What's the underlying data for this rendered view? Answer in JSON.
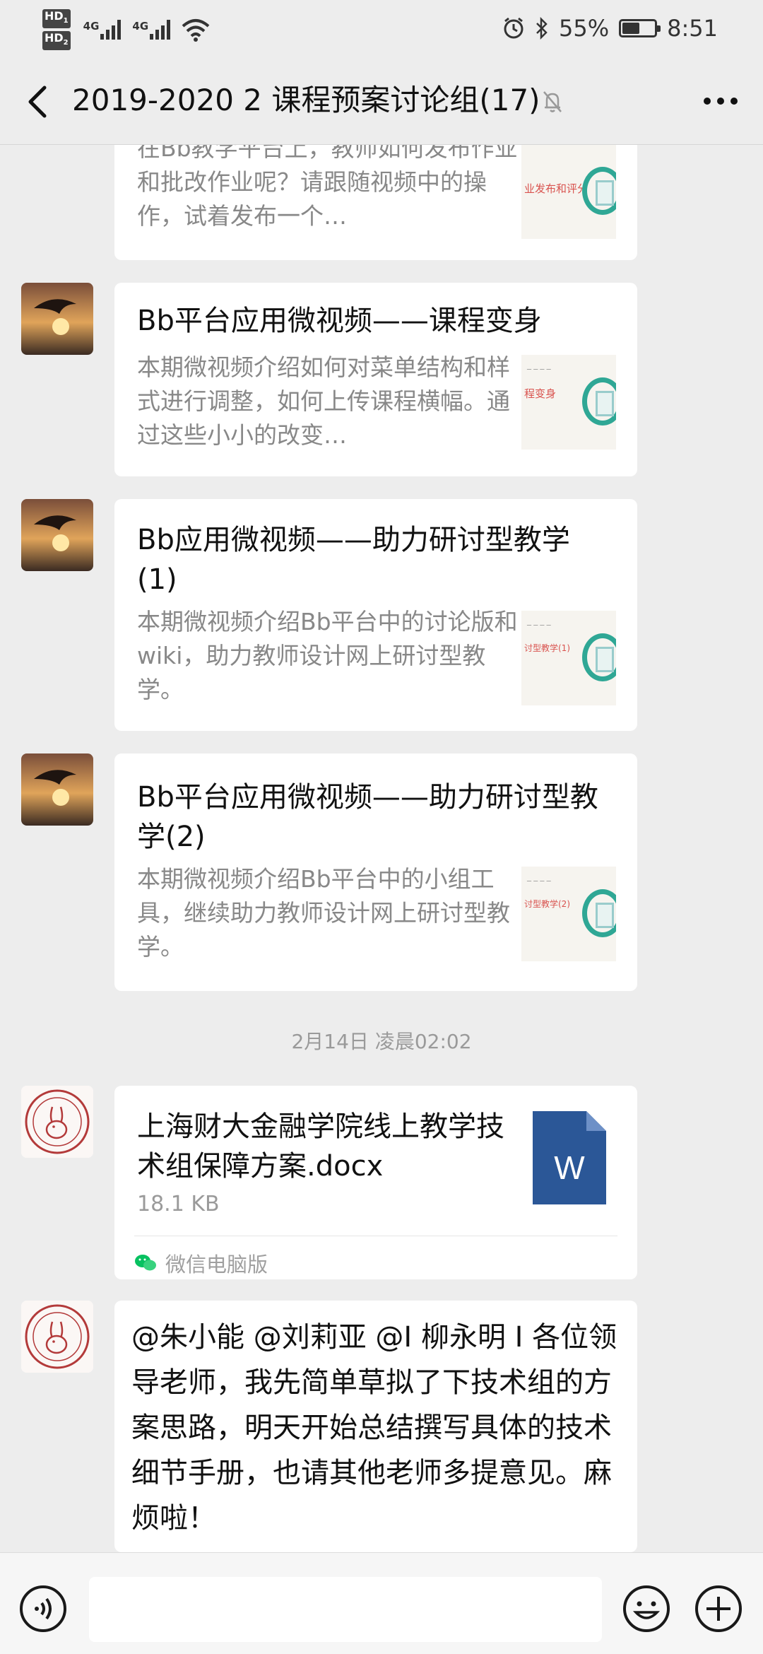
{
  "status_bar": {
    "hd_labels": [
      "HD",
      "HD"
    ],
    "hd_sub": [
      "1",
      "2"
    ],
    "signal_labels": [
      "4G",
      "4G"
    ],
    "battery_percent": "55%",
    "battery_level": 0.55,
    "time": "8:51"
  },
  "header": {
    "title": "2019-2020 2 课程预案讨论组(17)",
    "back_icon": "chevron-left-icon",
    "mute_icon": "bell-off-icon",
    "more_icon": "more-dots-icon"
  },
  "messages": [
    {
      "type": "link_card",
      "title": "",
      "description": "在Bb教学平台上，教师如何发布作业和批改作业呢？请跟随视频中的操作，试着发布一个…",
      "thumbnail_text": "业发布和评分"
    },
    {
      "type": "link_card",
      "title": "Bb平台应用微视频——课程变身",
      "description": "本期微视频介绍如何对菜单结构和样式进行调整，如何上传课程横幅。通过这些小小的改变…",
      "thumbnail_text": "程变身"
    },
    {
      "type": "link_card",
      "title": "Bb应用微视频——助力研讨型教学(1)",
      "description": "本期微视频介绍Bb平台中的讨论版和wiki，助力教师设计网上研讨型教学。",
      "thumbnail_text": "讨型教学(1)"
    },
    {
      "type": "link_card",
      "title": "Bb平台应用微视频——助力研讨型教学(2)",
      "description": "本期微视频介绍Bb平台中的小组工具，继续助力教师设计网上研讨型教学。",
      "thumbnail_text": "讨型教学(2)"
    }
  ],
  "timestamp": "2月14日 凌晨02:02",
  "file_message": {
    "name": "上海财大金融学院线上教学技术组保障方案.docx",
    "size": "18.1 KB",
    "icon_letter": "W",
    "source": "微信电脑版"
  },
  "text_message": {
    "text": "@朱小能 @刘莉亚 @I 柳永明 I 各位领导老师，我先简单草拟了下技术组的方案思路，明天开始总结撰写具体的技术细节手册，也请其他老师多提意见。麻烦啦！"
  },
  "input_bar": {
    "placeholder": "",
    "voice_icon": "voice-icon",
    "emoji_icon": "emoji-icon",
    "plus_icon": "plus-circle-icon"
  },
  "colors": {
    "background": "#ededed",
    "bubble": "#ffffff",
    "word_blue": "#2b5797",
    "wechat_green": "#07c160",
    "muted_text": "#888888"
  }
}
